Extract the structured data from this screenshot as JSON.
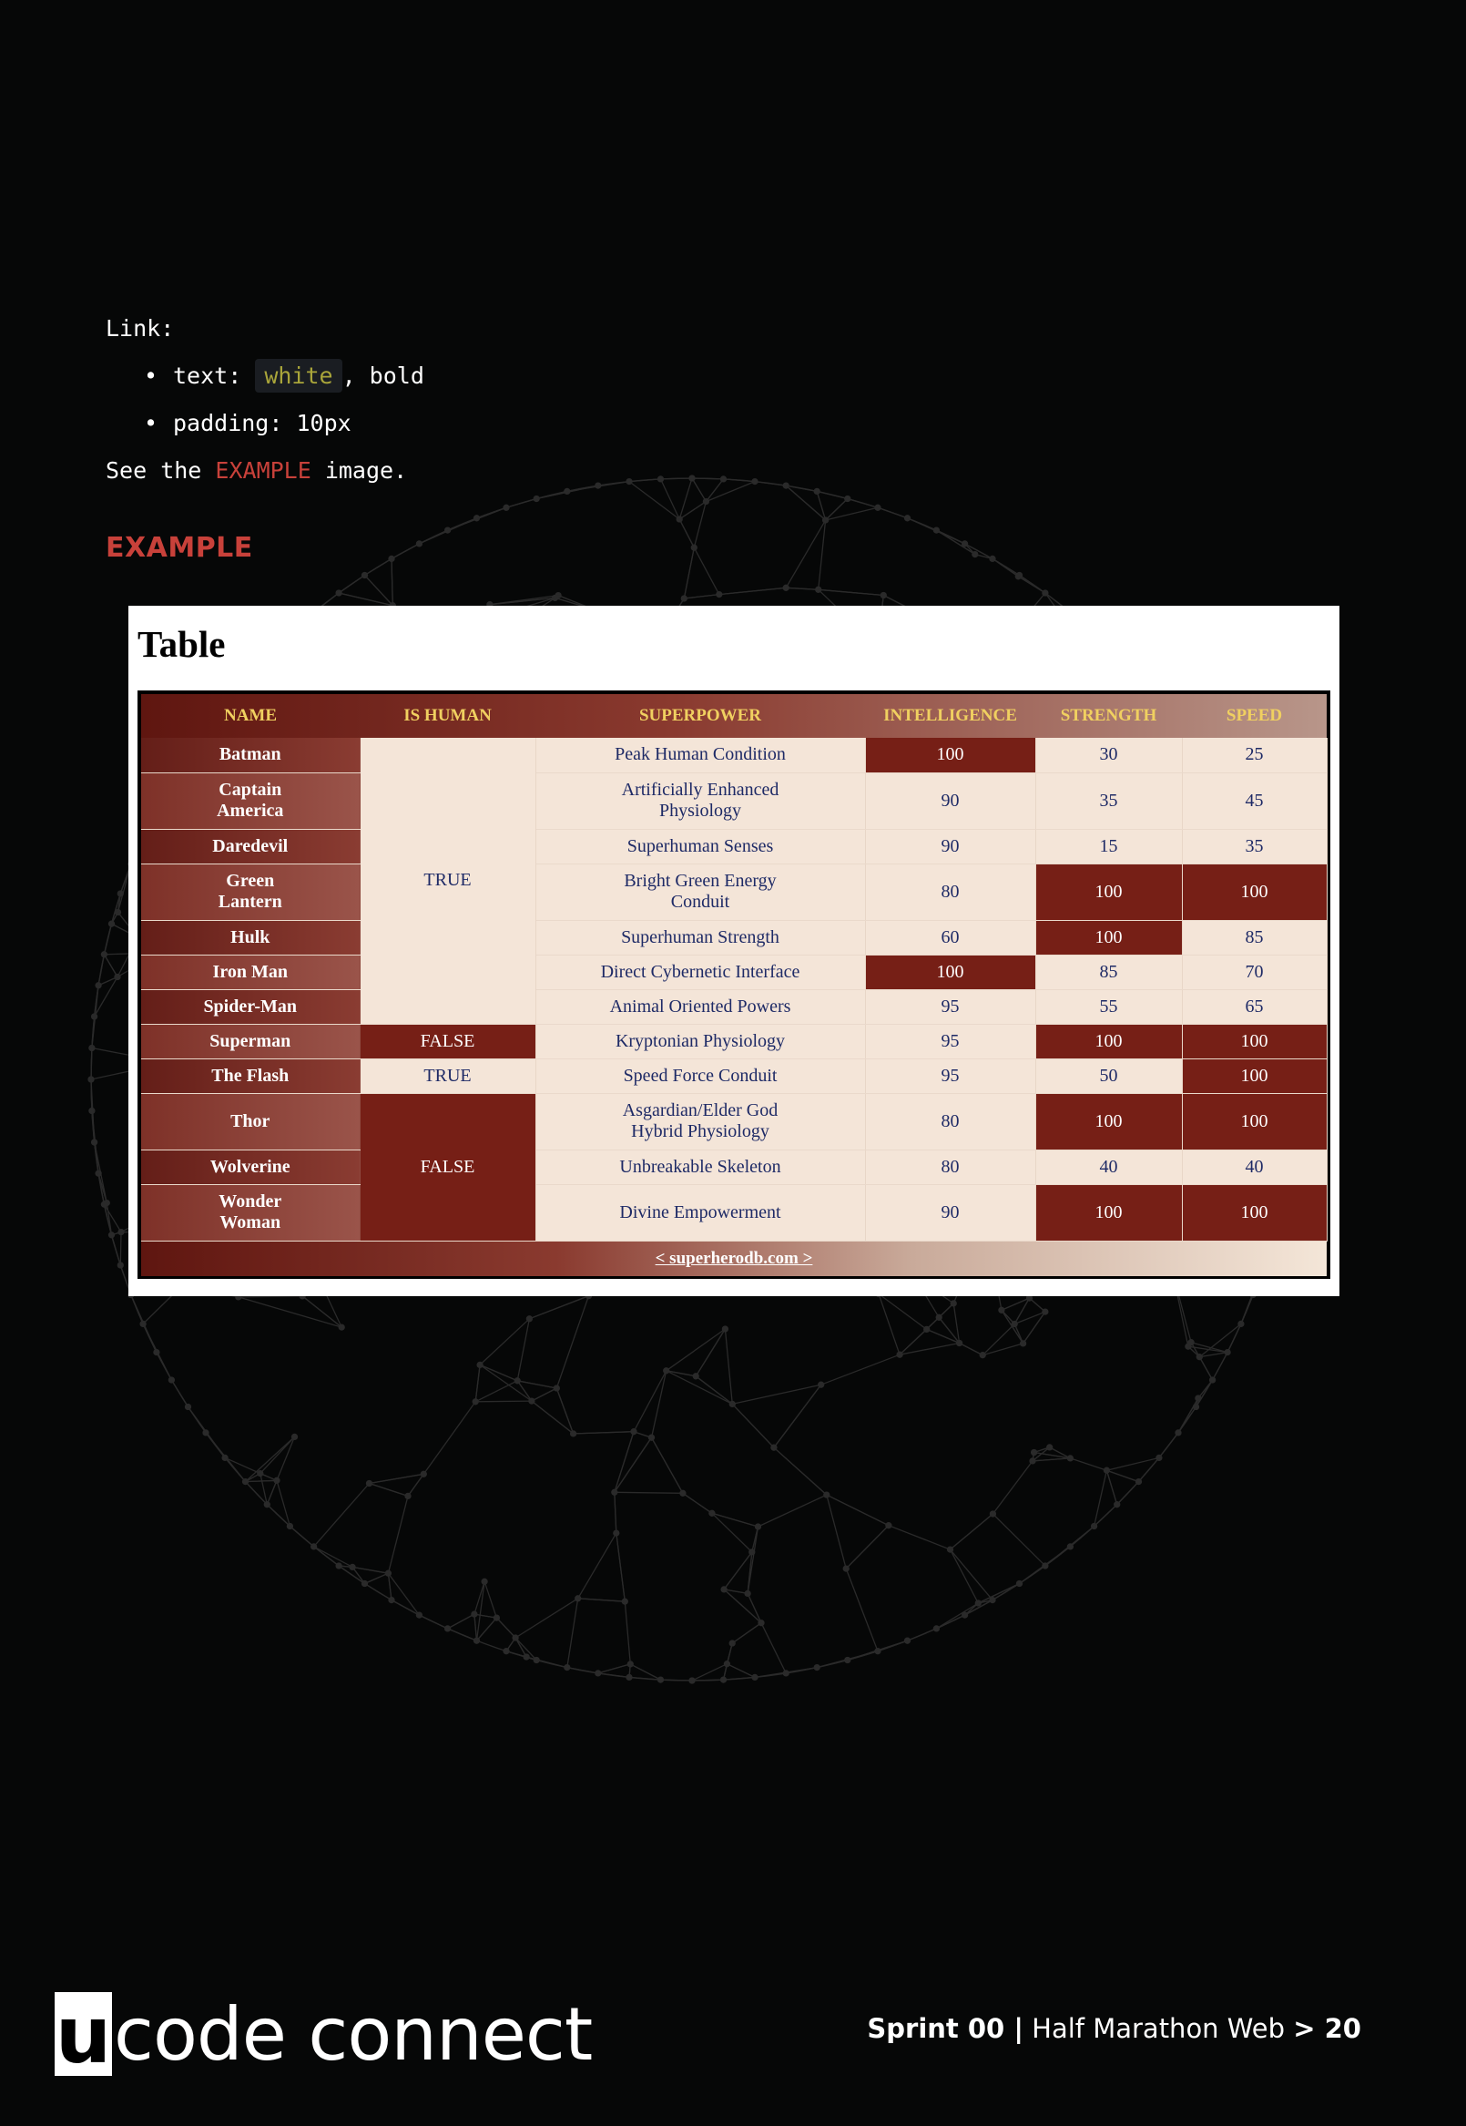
{
  "spec": {
    "link_heading": "Link:",
    "items": [
      {
        "prefix": "text: ",
        "code": "white",
        "suffix": ", bold"
      },
      {
        "prefix": "padding: 10px",
        "code": "",
        "suffix": ""
      }
    ],
    "see_prefix": "See the ",
    "see_highlight": "EXAMPLE",
    "see_suffix": " image."
  },
  "example_heading": "EXAMPLE",
  "example": {
    "title": "Table",
    "headers": [
      "NAME",
      "IS HUMAN",
      "SUPERPOWER",
      "INTELLIGENCE",
      "STRENGTH",
      "SPEED"
    ],
    "rows": [
      {
        "name": "Batman",
        "is_human": "TRUE",
        "superpower": "Peak Human Condition",
        "intelligence": "100",
        "strength": "30",
        "speed": "25"
      },
      {
        "name": "Captain America",
        "is_human": "TRUE",
        "superpower": "Artificially Enhanced Physiology",
        "intelligence": "90",
        "strength": "35",
        "speed": "45"
      },
      {
        "name": "Daredevil",
        "is_human": "TRUE",
        "superpower": "Superhuman Senses",
        "intelligence": "90",
        "strength": "15",
        "speed": "35"
      },
      {
        "name": "Green Lantern",
        "is_human": "TRUE",
        "superpower": "Bright Green Energy Conduit",
        "intelligence": "80",
        "strength": "100",
        "speed": "100"
      },
      {
        "name": "Hulk",
        "is_human": "TRUE",
        "superpower": "Superhuman Strength",
        "intelligence": "60",
        "strength": "100",
        "speed": "85"
      },
      {
        "name": "Iron Man",
        "is_human": "TRUE",
        "superpower": "Direct Cybernetic Interface",
        "intelligence": "100",
        "strength": "85",
        "speed": "70"
      },
      {
        "name": "Spider-Man",
        "is_human": "TRUE",
        "superpower": "Animal Oriented Powers",
        "intelligence": "95",
        "strength": "55",
        "speed": "65"
      },
      {
        "name": "Superman",
        "is_human": "FALSE",
        "superpower": "Kryptonian Physiology",
        "intelligence": "95",
        "strength": "100",
        "speed": "100"
      },
      {
        "name": "The Flash",
        "is_human": "TRUE",
        "superpower": "Speed Force Conduit",
        "intelligence": "95",
        "strength": "50",
        "speed": "100"
      },
      {
        "name": "Thor",
        "is_human": "FALSE",
        "superpower": "Asgardian/Elder God Hybrid Physiology",
        "intelligence": "80",
        "strength": "100",
        "speed": "100"
      },
      {
        "name": "Wolverine",
        "is_human": "FALSE",
        "superpower": "Unbreakable Skeleton",
        "intelligence": "80",
        "strength": "40",
        "speed": "40"
      },
      {
        "name": "Wonder Woman",
        "is_human": "FALSE",
        "superpower": "Divine Empowerment",
        "intelligence": "90",
        "strength": "100",
        "speed": "100"
      }
    ],
    "footer_link": "< superherodb.com >"
  },
  "footer": {
    "logo_letter": "u",
    "logo_text": "code connect",
    "sprint": "Sprint 00 |",
    "course": " Half Marathon Web ",
    "page": "> 20"
  },
  "colors": {
    "background": "#060707",
    "accent_red": "#c8413a",
    "highlight_cell": "#761f16",
    "cell_cream": "#f4e5d8",
    "header_text": "#f0d060",
    "cell_text": "#1e2a66",
    "code_chip_text": "#a9a53a"
  }
}
